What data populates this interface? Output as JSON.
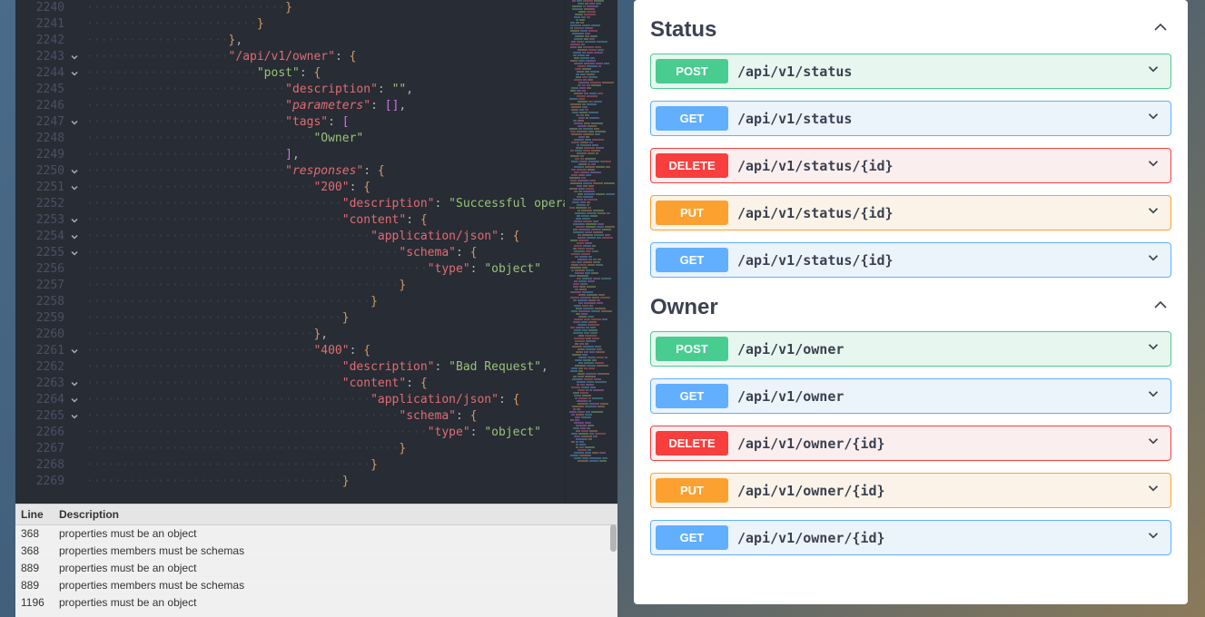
{
  "editor": {
    "lines": [
      {
        "num": 2240,
        "fold": false,
        "indent": 28,
        "tokens": [
          {
            "t": "}",
            "c": "brace"
          }
        ]
      },
      {
        "num": 2241,
        "fold": false,
        "indent": 24,
        "tokens": [
          {
            "t": "}",
            "c": "brace"
          }
        ]
      },
      {
        "num": 2242,
        "fold": false,
        "indent": 20,
        "tokens": [
          {
            "t": "}",
            "c": "brace"
          },
          {
            "t": ",",
            "c": "pun"
          }
        ]
      },
      {
        "num": 2243,
        "fold": true,
        "indent": 20,
        "tokens": [
          {
            "t": "\"/api/v1/owner\"",
            "c": "key"
          },
          {
            "t": ": ",
            "c": "pun"
          },
          {
            "t": "{",
            "c": "brace"
          }
        ]
      },
      {
        "num": 2244,
        "fold": true,
        "indent": 24,
        "tokens": [
          {
            "t": "\"post\"",
            "c": "keyg"
          },
          {
            "t": ": ",
            "c": "pun"
          },
          {
            "t": "{",
            "c": "brace"
          }
        ]
      },
      {
        "num": 2245,
        "fold": false,
        "indent": 28,
        "tokens": [
          {
            "t": "\"description\"",
            "c": "key"
          },
          {
            "t": ": ",
            "c": "pun"
          },
          {
            "t": "\"\"",
            "c": "str"
          },
          {
            "t": ",",
            "c": "pun"
          }
        ]
      },
      {
        "num": 2246,
        "fold": false,
        "indent": 28,
        "tokens": [
          {
            "t": "\"",
            "c": "key"
          },
          {
            "t": "parameters",
            "c": "em"
          },
          {
            "t": "\"",
            "c": "key"
          },
          {
            "t": ": ",
            "c": "pun"
          },
          {
            "t": "[]",
            "c": "brack"
          },
          {
            "t": ",",
            "c": "pun"
          }
        ]
      },
      {
        "num": 2247,
        "fold": true,
        "indent": 28,
        "tokens": [
          {
            "t": "\"tags\"",
            "c": "key"
          },
          {
            "t": ": ",
            "c": "pun"
          },
          {
            "t": "[",
            "c": "brack"
          }
        ]
      },
      {
        "num": 2248,
        "fold": false,
        "indent": 32,
        "tokens": [
          {
            "t": "\"Owner\"",
            "c": "str"
          }
        ]
      },
      {
        "num": 2249,
        "fold": false,
        "indent": 28,
        "tokens": [
          {
            "t": "]",
            "c": "brack"
          },
          {
            "t": ",",
            "c": "pun"
          }
        ]
      },
      {
        "num": 2250,
        "fold": true,
        "indent": 28,
        "tokens": [
          {
            "t": "\"",
            "c": "key"
          },
          {
            "t": "responses",
            "c": "em"
          },
          {
            "t": "\"",
            "c": "key"
          },
          {
            "t": ": ",
            "c": "pun"
          },
          {
            "t": "{",
            "c": "brace"
          }
        ]
      },
      {
        "num": 2251,
        "fold": true,
        "indent": 32,
        "tokens": [
          {
            "t": "\"200\"",
            "c": "key"
          },
          {
            "t": ": ",
            "c": "pun"
          },
          {
            "t": "{",
            "c": "brace"
          }
        ]
      },
      {
        "num": 2252,
        "fold": false,
        "indent": 36,
        "tokens": [
          {
            "t": "\"description\"",
            "c": "key"
          },
          {
            "t": ": ",
            "c": "pun"
          },
          {
            "t": "\"Successful operation\"",
            "c": "str"
          },
          {
            "t": ",",
            "c": "pun"
          }
        ]
      },
      {
        "num": 2253,
        "fold": true,
        "indent": 36,
        "tokens": [
          {
            "t": "\"content\"",
            "c": "key"
          },
          {
            "t": ": ",
            "c": "pun"
          },
          {
            "t": "{",
            "c": "brace"
          }
        ]
      },
      {
        "num": 2254,
        "fold": true,
        "indent": 40,
        "tokens": [
          {
            "t": "\"application/json\"",
            "c": "key"
          },
          {
            "t": ": ",
            "c": "pun"
          },
          {
            "t": "{",
            "c": "brace"
          }
        ]
      },
      {
        "num": 2255,
        "fold": true,
        "indent": 44,
        "tokens": [
          {
            "t": "\"schema\"",
            "c": "key"
          },
          {
            "t": ": ",
            "c": "pun"
          },
          {
            "t": "{",
            "c": "brace"
          }
        ]
      },
      {
        "num": 2256,
        "fold": false,
        "indent": 48,
        "tokens": [
          {
            "t": "\"type\"",
            "c": "key"
          },
          {
            "t": ": ",
            "c": "pun"
          },
          {
            "t": "\"object\"",
            "c": "str"
          }
        ]
      },
      {
        "num": 2257,
        "fold": false,
        "indent": 44,
        "tokens": [
          {
            "t": "}",
            "c": "brace"
          }
        ]
      },
      {
        "num": 2258,
        "fold": false,
        "indent": 40,
        "tokens": [
          {
            "t": "}",
            "c": "brace"
          }
        ]
      },
      {
        "num": 2259,
        "fold": false,
        "indent": 36,
        "tokens": [
          {
            "t": "}",
            "c": "brace"
          }
        ]
      },
      {
        "num": 2260,
        "fold": false,
        "indent": 32,
        "tokens": [
          {
            "t": "}",
            "c": "brace"
          },
          {
            "t": ",",
            "c": "pun"
          }
        ]
      },
      {
        "num": 2261,
        "fold": true,
        "indent": 32,
        "tokens": [
          {
            "t": "\"400\"",
            "c": "key"
          },
          {
            "t": ": ",
            "c": "pun"
          },
          {
            "t": "{",
            "c": "brace"
          }
        ]
      },
      {
        "num": 2262,
        "fold": false,
        "indent": 36,
        "tokens": [
          {
            "t": "\"description\"",
            "c": "key"
          },
          {
            "t": ": ",
            "c": "pun"
          },
          {
            "t": "\"Bad Request\"",
            "c": "str"
          },
          {
            "t": ",",
            "c": "pun"
          }
        ]
      },
      {
        "num": 2263,
        "fold": true,
        "indent": 36,
        "tokens": [
          {
            "t": "\"content\"",
            "c": "key"
          },
          {
            "t": ": ",
            "c": "pun"
          },
          {
            "t": "{",
            "c": "brace"
          }
        ]
      },
      {
        "num": 2264,
        "fold": true,
        "indent": 40,
        "tokens": [
          {
            "t": "\"application/json\"",
            "c": "key"
          },
          {
            "t": ": ",
            "c": "pun"
          },
          {
            "t": "{",
            "c": "brace"
          }
        ]
      },
      {
        "num": 2265,
        "fold": true,
        "indent": 44,
        "tokens": [
          {
            "t": "\"schema\"",
            "c": "key"
          },
          {
            "t": ": ",
            "c": "pun"
          },
          {
            "t": "{",
            "c": "brace"
          }
        ]
      },
      {
        "num": 2266,
        "fold": false,
        "indent": 48,
        "tokens": [
          {
            "t": "\"type\"",
            "c": "key"
          },
          {
            "t": ": ",
            "c": "pun"
          },
          {
            "t": "\"object\"",
            "c": "str"
          }
        ]
      },
      {
        "num": 2267,
        "fold": false,
        "indent": 44,
        "tokens": [
          {
            "t": "}",
            "c": "brace"
          }
        ]
      },
      {
        "num": 2268,
        "fold": false,
        "indent": 40,
        "tokens": [
          {
            "t": "}",
            "c": "brace"
          }
        ]
      },
      {
        "num": 2269,
        "fold": false,
        "indent": 36,
        "tokens": [
          {
            "t": "}",
            "c": "brace"
          }
        ]
      }
    ]
  },
  "problems": {
    "header_line": "Line",
    "header_desc": "Description",
    "rows": [
      {
        "line": "368",
        "desc": "properties must be an object"
      },
      {
        "line": "368",
        "desc": "properties members must be schemas"
      },
      {
        "line": "889",
        "desc": "properties must be an object"
      },
      {
        "line": "889",
        "desc": "properties members must be schemas"
      },
      {
        "line": "1196",
        "desc": "properties must be an object"
      }
    ]
  },
  "swagger": {
    "sections": [
      {
        "title": "Status",
        "endpoints": [
          {
            "method": "POST",
            "path": "/api/v1/status"
          },
          {
            "method": "GET",
            "path": "/api/v1/status"
          },
          {
            "method": "DELETE",
            "path": "/api/v1/status/{id}"
          },
          {
            "method": "PUT",
            "path": "/api/v1/status/{id}"
          },
          {
            "method": "GET",
            "path": "/api/v1/status/{id}"
          }
        ]
      },
      {
        "title": "Owner",
        "endpoints": [
          {
            "method": "POST",
            "path": "/api/v1/owner"
          },
          {
            "method": "GET",
            "path": "/api/v1/owner"
          },
          {
            "method": "DELETE",
            "path": "/api/v1/owner/{id}"
          },
          {
            "method": "PUT",
            "path": "/api/v1/owner/{id}"
          },
          {
            "method": "GET",
            "path": "/api/v1/owner/{id}"
          }
        ]
      }
    ]
  }
}
